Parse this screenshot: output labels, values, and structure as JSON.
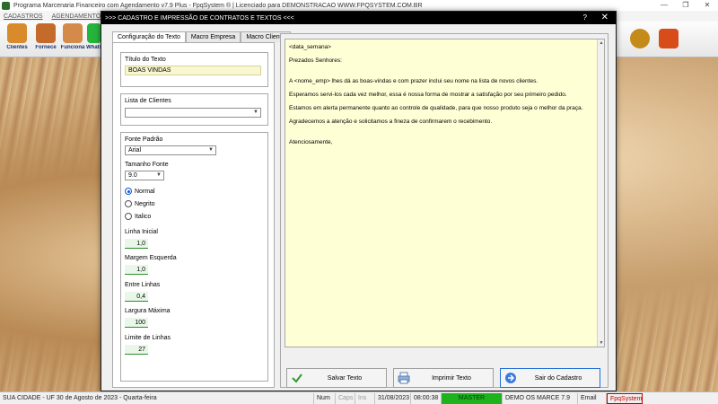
{
  "app": {
    "title": "Programa Marcenaria Financeiro com Agendamento v7.9 Plus - FpqSystem ® | Licenciado para  DEMONSTRACAO WWW.FPQSYSTEM.COM.BR",
    "window_controls": [
      "—",
      "❐",
      "✕"
    ]
  },
  "menubar": [
    "CADASTROS",
    "AGENDAMENTO"
  ],
  "toolbar": [
    {
      "label": "Clientes",
      "icon": "clients-icon",
      "color": "#d98a2b"
    },
    {
      "label": "Fornece",
      "icon": "suppliers-icon",
      "color": "#c46a2a"
    },
    {
      "label": "Funciona",
      "icon": "employees-icon",
      "color": "#d48b4a"
    },
    {
      "label": "Whats",
      "icon": "whatsapp-icon",
      "color": "#25b43c"
    }
  ],
  "toolbar_right": [
    {
      "icon": "money-icon",
      "color": "#c48a1a"
    },
    {
      "icon": "exit-icon",
      "color": "#d84c1a"
    }
  ],
  "dialog": {
    "title": ">>>  CADASTRO E IMPRESSÃO DE CONTRATOS E TEXTOS  <<<",
    "help": "?",
    "close": "✕",
    "tabs": [
      "Configuração do Texto",
      "Macro Empresa",
      "Macro Cliente"
    ],
    "form": {
      "title_label": "Título do Texto",
      "title_value": "BOAS VINDAS",
      "clients_label": "Lista de Clientes",
      "clients_value": "",
      "font_label": "Fonte Padrão",
      "font_value": "Arial",
      "size_label": "Tamanho Fonte",
      "size_value": "9.0",
      "style_options": [
        "Normal",
        "Negrito",
        "Italico"
      ],
      "style_selected": "Normal",
      "line_start_label": "Linha Inicial",
      "line_start_value": "1,0",
      "left_margin_label": "Margem Esquerda",
      "left_margin_value": "1,0",
      "line_spacing_label": "Entre Linhas",
      "line_spacing_value": "0,4",
      "max_width_label": "Largura Máxima",
      "max_width_value": "100",
      "line_limit_label": "Limite de Linhas",
      "line_limit_value": "27"
    },
    "editor_lines": [
      "<data_semana>",
      "Prezados Senhores:",
      "A <nome_emp> lhes dá as boas-vindas e com prazer inclui seu nome na lista de novos clientes.",
      "Esperamos servi-los cada vez melhor, essa é nossa forma de mostrar a satisfação por seu primeiro pedido.",
      "Estamos em alerta permanente quanto ao controle de qualidade, para que nosso produto seja o melhor da praça.",
      "Agradecemos a atenção e solicitamos a fineza de confirmarem o recebimento.",
      "Atenciosamente,"
    ],
    "buttons": {
      "save": "Salvar Texto",
      "print": "Imprimir Texto",
      "exit": "Sair do Cadastro"
    }
  },
  "statusbar": {
    "city": "SUA CIDADE - UF 30 de Agosto de 2023 - Quarta-feira",
    "num": "Num",
    "caps": "Caps",
    "ins": "Ins",
    "date": "31/08/2023",
    "time": "08:00:38",
    "master": "MASTER",
    "demo": "DEMO OS MARCE 7.9",
    "email": "Email",
    "brand": "FpqSystem"
  }
}
